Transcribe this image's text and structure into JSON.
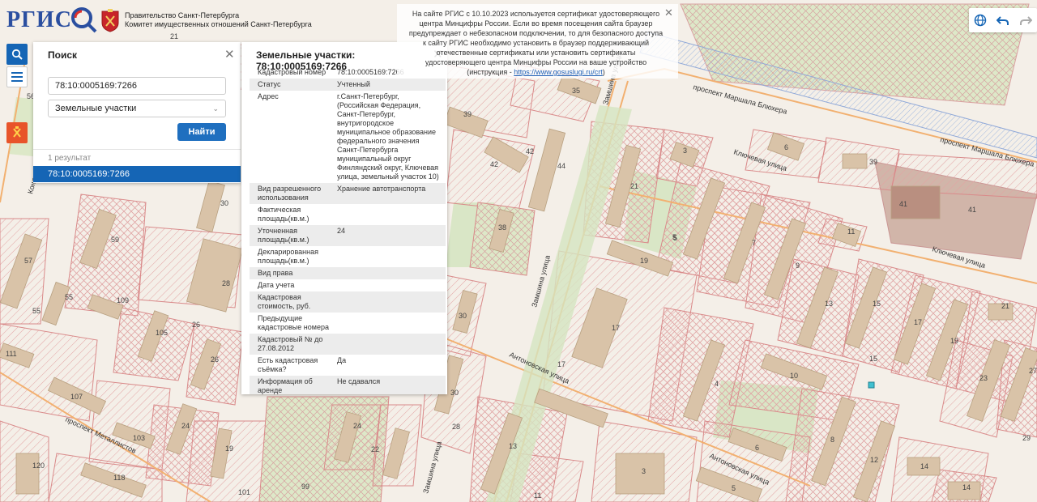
{
  "brand": {
    "logo_text": "РГИС",
    "gov_line1": "Правительство Санкт-Петербурга",
    "gov_line2": "Комитет имущественных отношений Санкт-Петербурга"
  },
  "search_panel": {
    "title": "Поиск",
    "query_value": "78:10:0005169:7266",
    "layer_value": "Земельные участки",
    "find_label": "Найти",
    "result_count": "1 результат",
    "results": [
      "78:10:0005169:7266"
    ]
  },
  "info_panel": {
    "title": "Земельные участки: 78:10:0005169:7266",
    "rows": [
      {
        "k": "Кадастровый номер",
        "v": "78:10:0005169:7266"
      },
      {
        "k": "Статус",
        "v": "Учтенный"
      },
      {
        "k": "Адрес",
        "v": "г.Санкт-Петербург, (Российская Федерация, Санкт-Петербург, внутригородское муниципальное образование федерального значения Санкт-Петербурга муниципальный округ Финляндский округ, Ключевая улица, земельный участок 10)"
      },
      {
        "k": "Вид разрешенного использования",
        "v": "Хранение автотранспорта"
      },
      {
        "k": "Фактическая площадь(кв.м.)",
        "v": ""
      },
      {
        "k": "Уточненная площадь(кв.м.)",
        "v": "24"
      },
      {
        "k": "Декларированная площадь(кв.м.)",
        "v": ""
      },
      {
        "k": "Вид права",
        "v": ""
      },
      {
        "k": "Дата учета",
        "v": ""
      },
      {
        "k": "Кадастровая стоимость, руб.",
        "v": ""
      },
      {
        "k": "Предыдущие кадастровые номера",
        "v": ""
      },
      {
        "k": "Кадастровый № до 27.08.2012",
        "v": ""
      },
      {
        "k": "Есть кадастровая съёмка?",
        "v": "Да"
      },
      {
        "k": "Информация об аренде",
        "v": "Не сдавался"
      }
    ]
  },
  "notice": {
    "text": "На сайте РГИС с 10.10.2023 используется сертификат удостоверяющего центра Минцифры России. Если во время посещения сайта браузер предупреждает о небезопасном подключении, то для безопасного доступа к сайту РГИС необходимо установить в браузер поддерживающий отечественные сертификаты или установить сертификаты удостоверяющего центра Минцифры России на ваше устройство (инструкция - ",
    "link": "https://www.gosuslugi.ru/crt",
    "tail": ")"
  },
  "map": {
    "streets": [
      "проспект Маршала Блюхера",
      "проспект Маршала Блюхера",
      "Ключевая улица",
      "Ключевая улица",
      "Антоновская улица",
      "Антоновская улица",
      "Замшина улица",
      "Замшина улица",
      "Замшина улица",
      "проспект Металлистов",
      "Кондратьевский"
    ],
    "parcel_numbers": [
      "21",
      "56",
      "59",
      "57",
      "55",
      "55",
      "109",
      "105",
      "26",
      "26",
      "111",
      "107",
      "103",
      "24",
      "19",
      "101",
      "120",
      "118",
      "30",
      "28",
      "30",
      "39",
      "42",
      "42",
      "35",
      "44",
      "38",
      "30",
      "28",
      "24",
      "22",
      "99",
      "21",
      "3",
      "5",
      "6",
      "39",
      "41",
      "41",
      "11",
      "7",
      "9",
      "19",
      "17",
      "13",
      "15",
      "17",
      "19",
      "21",
      "23",
      "27",
      "10",
      "4",
      "6",
      "8",
      "12",
      "14",
      "14",
      "15",
      "17",
      "13",
      "11",
      "3",
      "5",
      "29",
      "5"
    ]
  },
  "icons": {
    "search": "search-icon",
    "menu": "menu-icon",
    "emblem": "spb-emblem-icon",
    "globe": "globe-icon",
    "undo": "undo-icon",
    "redo": "redo-icon",
    "close": "close-icon"
  },
  "colors": {
    "accent": "#1565b5",
    "parcel_stroke": "#d98a8a",
    "road": "#f0a050",
    "green": "#c8dfb4",
    "building": "#d9c3a8"
  }
}
